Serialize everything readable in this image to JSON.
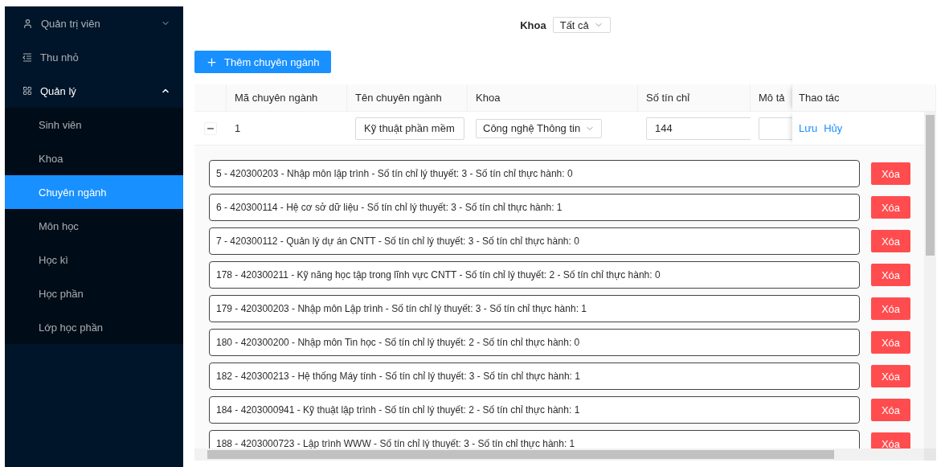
{
  "sidebar": {
    "items": [
      {
        "kind": "user",
        "label": "Quản trị viên",
        "expanded": false
      },
      {
        "kind": "collapse",
        "label": "Thu nhỏ"
      },
      {
        "kind": "group",
        "label": "Quản lý",
        "expanded": true,
        "children": [
          {
            "label": "Sinh viên",
            "selected": false
          },
          {
            "label": "Khoa",
            "selected": false
          },
          {
            "label": "Chuyên ngành",
            "selected": true
          },
          {
            "label": "Môn học",
            "selected": false
          },
          {
            "label": "Học kì",
            "selected": false
          },
          {
            "label": "Học phần",
            "selected": false
          },
          {
            "label": "Lớp học phần",
            "selected": false
          }
        ]
      }
    ]
  },
  "filter": {
    "label": "Khoa",
    "value": "Tất cả"
  },
  "add_button": {
    "label": "Thêm chuyên ngành"
  },
  "table": {
    "columns": [
      "Mã chuyên ngành",
      "Tên chuyên ngành",
      "Khoa",
      "Số tín chỉ",
      "Mô tả",
      "Thao tác"
    ],
    "rows": [
      {
        "expanded": true,
        "code": "1",
        "name": "Kỹ thuật phần mềm",
        "faculty": "Công nghệ Thông tin",
        "credits": "144",
        "actions": [
          "Lưu",
          "Hủy"
        ],
        "courses": [
          {
            "text": "5 - 420300203 - Nhập môn lập trình - Số tín chỉ lý thuyết: 3 - Số tín chỉ thực hành: 0",
            "action": "Xóa"
          },
          {
            "text": "6 - 420300114 - Hệ cơ sở dữ liệu - Số tín chỉ lý thuyết: 3 - Số tín chỉ thực hành: 1",
            "action": "Xóa"
          },
          {
            "text": "7 - 420300112 - Quản lý dự án CNTT - Số tín chỉ lý thuyết: 3 - Số tín chỉ thực hành: 0",
            "action": "Xóa"
          },
          {
            "text": "178 - 420300211 - Kỹ năng học tập trong lĩnh vực CNTT - Số tín chỉ lý thuyết: 2 - Số tín chỉ thực hành: 0",
            "action": "Xóa"
          },
          {
            "text": "179 - 420300203 - Nhập môn Lập trình - Số tín chỉ lý thuyết: 3 - Số tín chỉ thực hành: 1",
            "action": "Xóa"
          },
          {
            "text": "180 - 420300200 - Nhập môn Tin học - Số tín chỉ lý thuyết: 2 - Số tín chỉ thực hành: 0",
            "action": "Xóa"
          },
          {
            "text": "182 - 420300213 - Hệ thống Máy tính - Số tín chỉ lý thuyết: 3 - Số tín chỉ thực hành: 1",
            "action": "Xóa"
          },
          {
            "text": "184 - 4203000941 - Kỹ thuật lập trình - Số tín chỉ lý thuyết: 2 - Số tín chỉ thực hành: 1",
            "action": "Xóa"
          },
          {
            "text": "188 - 4203000723 - Lập trình WWW - Số tín chỉ lý thuyết: 3 - Số tín chỉ thực hành: 1",
            "action": "Xóa"
          }
        ]
      }
    ]
  }
}
